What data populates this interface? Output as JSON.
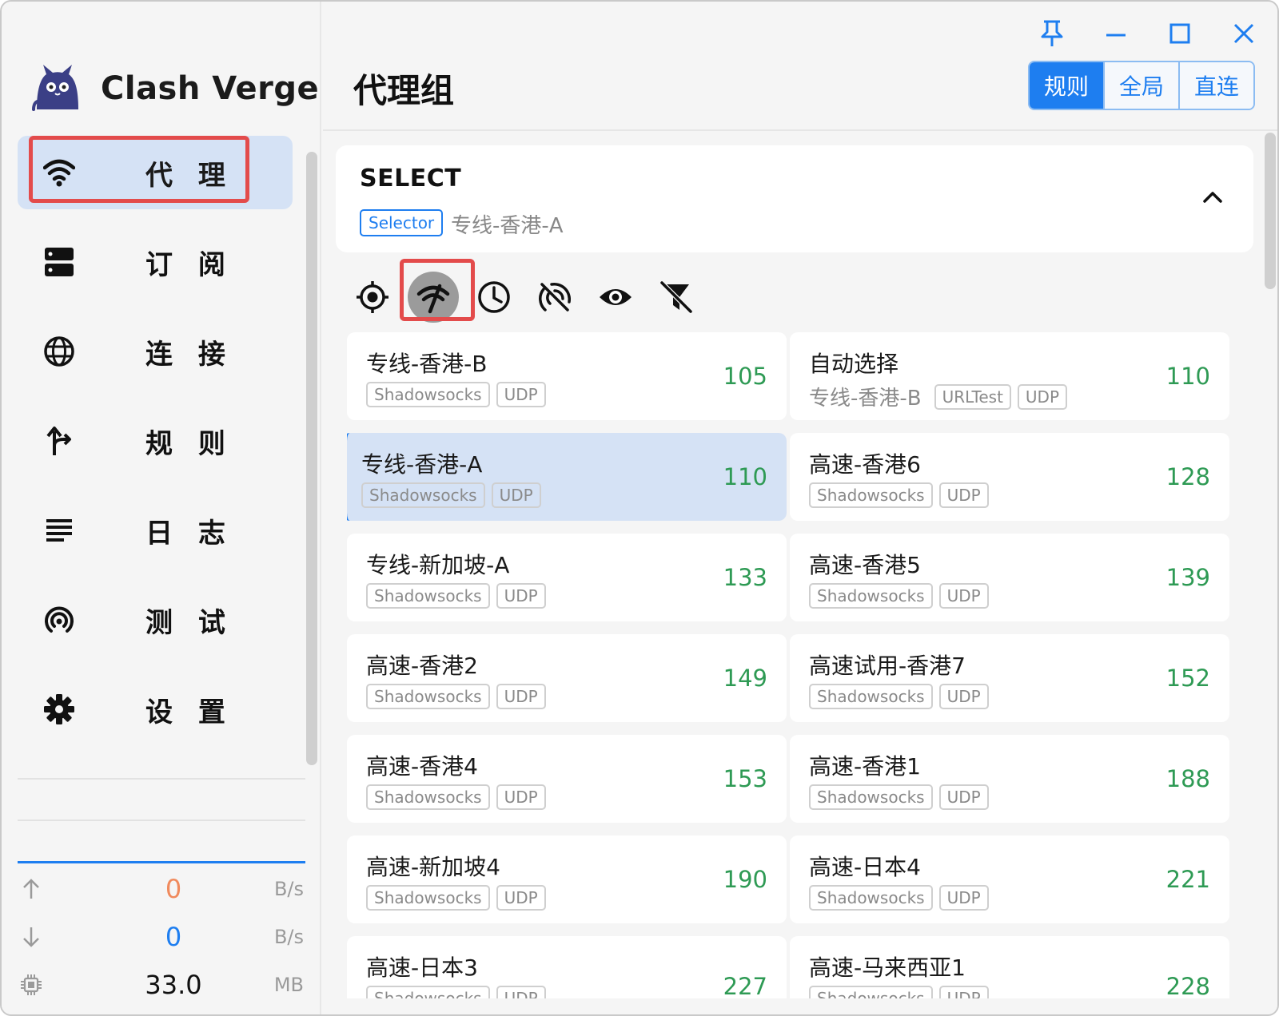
{
  "app": {
    "name": "Clash Verge"
  },
  "nav": [
    {
      "id": "proxy",
      "label": "代 理",
      "icon": "wifi-icon",
      "active": true
    },
    {
      "id": "profiles",
      "label": "订 阅",
      "icon": "server-icon",
      "active": false
    },
    {
      "id": "connections",
      "label": "连 接",
      "icon": "globe-icon",
      "active": false
    },
    {
      "id": "rules",
      "label": "规 则",
      "icon": "fork-arrow-icon",
      "active": false
    },
    {
      "id": "logs",
      "label": "日 志",
      "icon": "list-lines-icon",
      "active": false
    },
    {
      "id": "test",
      "label": "测 试",
      "icon": "signal-rings-icon",
      "active": false
    },
    {
      "id": "settings",
      "label": "设 置",
      "icon": "gear-icon",
      "active": false
    }
  ],
  "traffic": {
    "upload": {
      "value": "0",
      "unit": "B/s",
      "color": "#f08a5d"
    },
    "download": {
      "value": "0",
      "unit": "B/s",
      "color": "#1e7ef0"
    },
    "memory": {
      "value": "33.0",
      "unit": "MB"
    }
  },
  "header": {
    "title": "代理组",
    "modes": [
      {
        "label": "规则",
        "active": true
      },
      {
        "label": "全局",
        "active": false
      },
      {
        "label": "直连",
        "active": false
      }
    ]
  },
  "group": {
    "name": "SELECT",
    "type": "Selector",
    "now": "专线-香港-A"
  },
  "toolbar": [
    {
      "icon": "locate-icon",
      "selected": false
    },
    {
      "icon": "network-check-icon",
      "selected": true
    },
    {
      "icon": "clock-icon",
      "selected": false
    },
    {
      "icon": "signal-off-icon",
      "selected": false
    },
    {
      "icon": "eye-icon",
      "selected": false
    },
    {
      "icon": "filter-off-icon",
      "selected": false
    }
  ],
  "proxies": [
    {
      "name": "专线-香港-B",
      "tags": [
        "Shadowsocks",
        "UDP"
      ],
      "delay": "105",
      "active": false
    },
    {
      "name": "自动选择",
      "now": "专线-香港-B",
      "tags": [
        "URLTest",
        "UDP"
      ],
      "delay": "110",
      "active": false
    },
    {
      "name": "专线-香港-A",
      "tags": [
        "Shadowsocks",
        "UDP"
      ],
      "delay": "110",
      "active": true
    },
    {
      "name": "高速-香港6",
      "tags": [
        "Shadowsocks",
        "UDP"
      ],
      "delay": "128",
      "active": false
    },
    {
      "name": "专线-新加坡-A",
      "tags": [
        "Shadowsocks",
        "UDP"
      ],
      "delay": "133",
      "active": false
    },
    {
      "name": "高速-香港5",
      "tags": [
        "Shadowsocks",
        "UDP"
      ],
      "delay": "139",
      "active": false
    },
    {
      "name": "高速-香港2",
      "tags": [
        "Shadowsocks",
        "UDP"
      ],
      "delay": "149",
      "active": false
    },
    {
      "name": "高速试用-香港7",
      "tags": [
        "Shadowsocks",
        "UDP"
      ],
      "delay": "152",
      "active": false
    },
    {
      "name": "高速-香港4",
      "tags": [
        "Shadowsocks",
        "UDP"
      ],
      "delay": "153",
      "active": false
    },
    {
      "name": "高速-香港1",
      "tags": [
        "Shadowsocks",
        "UDP"
      ],
      "delay": "188",
      "active": false
    },
    {
      "name": "高速-新加坡4",
      "tags": [
        "Shadowsocks",
        "UDP"
      ],
      "delay": "190",
      "active": false
    },
    {
      "name": "高速-日本4",
      "tags": [
        "Shadowsocks",
        "UDP"
      ],
      "delay": "221",
      "active": false
    },
    {
      "name": "高速-日本3",
      "tags": [
        "Shadowsocks",
        "UDP"
      ],
      "delay": "227",
      "active": false
    },
    {
      "name": "高速-马来西亚1",
      "tags": [
        "Shadowsocks",
        "UDP"
      ],
      "delay": "228",
      "active": false
    }
  ]
}
